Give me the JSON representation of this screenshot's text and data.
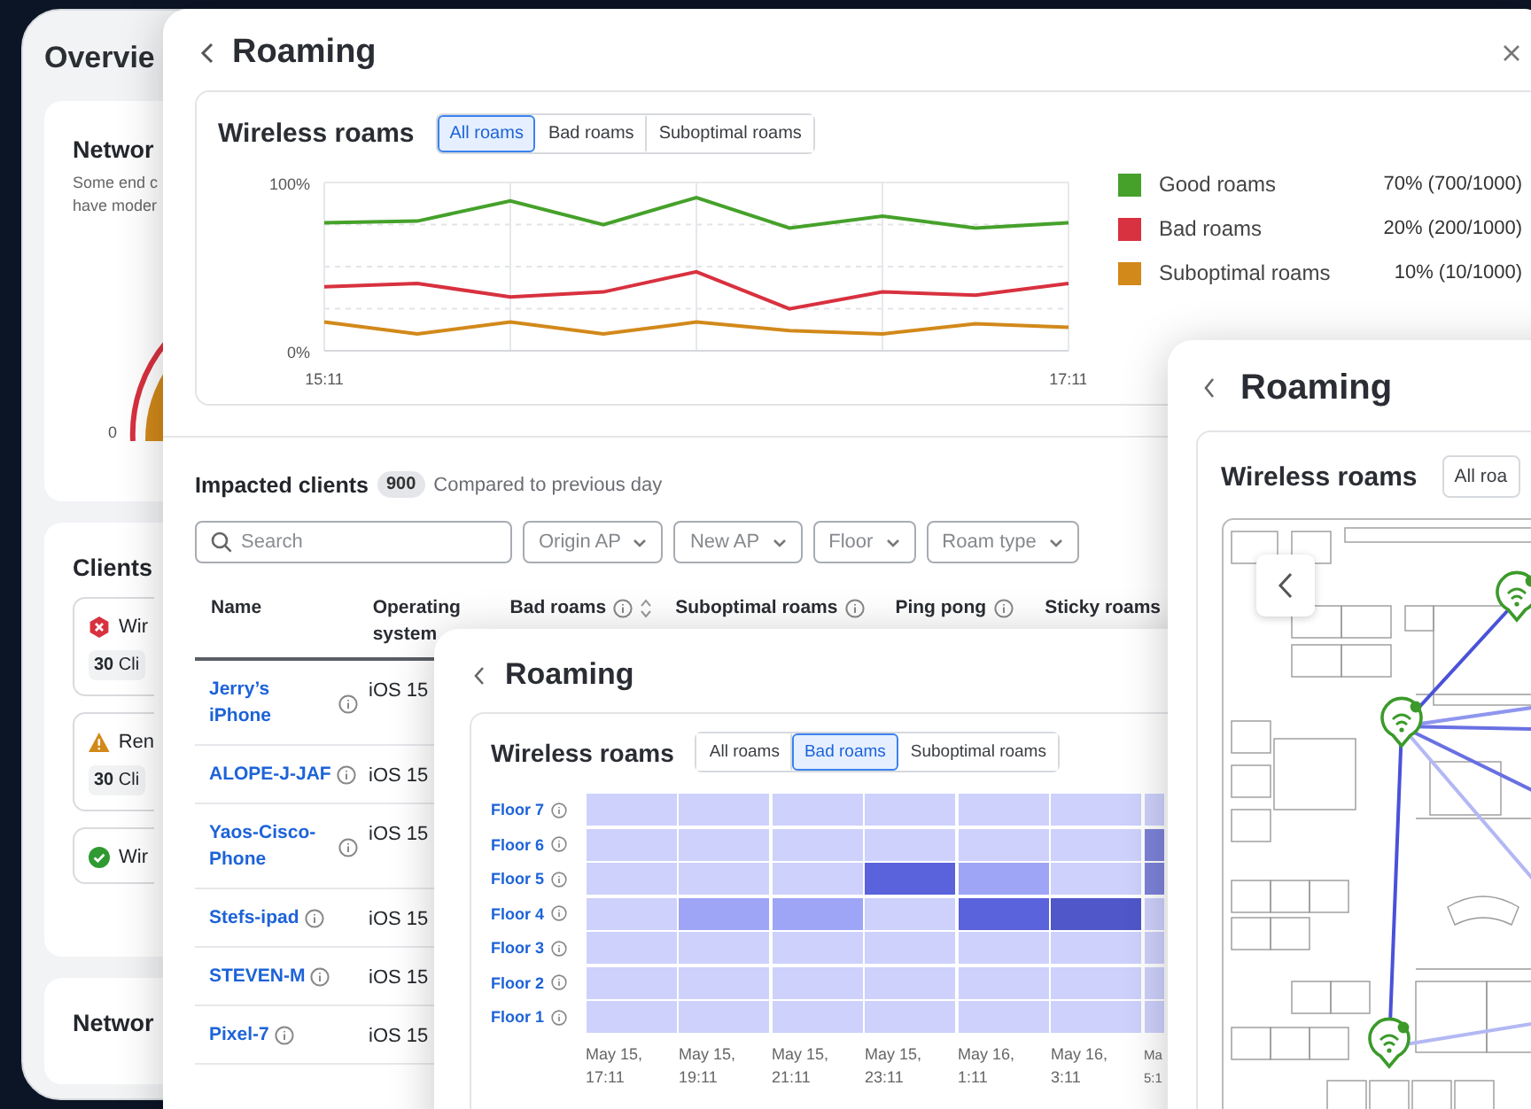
{
  "overview": {
    "title": "Overvie",
    "network_card": {
      "title": "Networ",
      "description_lines": [
        "Some end c",
        "have moder"
      ],
      "gauge_label": "0"
    },
    "clients_card": {
      "title": "Clients",
      "items": [
        {
          "kind": "error",
          "label": "Wir",
          "count": "**30** Cli"
        },
        {
          "kind": "warning",
          "label": "Ren",
          "count": "**30** Cli"
        },
        {
          "kind": "ok",
          "label": "Wir"
        }
      ]
    },
    "network_card_2": {
      "title": "Networ"
    }
  },
  "main_panel": {
    "title": "Roaming",
    "roams_card": {
      "title": "Wireless roams",
      "tabs": [
        {
          "label": "All roams",
          "selected": true
        },
        {
          "label": "Bad roams",
          "selected": false
        },
        {
          "label": "Suboptimal roams",
          "selected": false
        }
      ],
      "chart_data": {
        "type": "line",
        "grid": true,
        "categories": [
          "15:11",
          null,
          null,
          null,
          null,
          null,
          null,
          null,
          "17:11"
        ],
        "ylim": [
          0,
          100
        ],
        "yticks": [
          {
            "value": 0,
            "label": "0%"
          },
          {
            "value": 100,
            "label": "100%"
          }
        ],
        "series": [
          {
            "name": "Good roams",
            "color": "#45a12a",
            "values": [
              76,
              77,
              89,
              75,
              91,
              73,
              80,
              73,
              76
            ]
          },
          {
            "name": "Bad roams",
            "color": "#d8313f",
            "values": [
              38,
              40,
              32,
              35,
              47,
              25,
              35,
              33,
              40
            ]
          },
          {
            "name": "Suboptimal roams",
            "color": "#d2891a",
            "values": [
              17,
              10,
              17,
              10,
              17,
              12,
              10,
              16,
              14
            ]
          }
        ]
      },
      "legend_values": [
        "70% (700/1000)",
        "20% (200/1000)",
        "10% (10/1000)"
      ]
    },
    "clients": {
      "title": "Impacted clients",
      "count": "900",
      "comparison": "Compared to previous day",
      "search": {
        "placeholder": "Search"
      },
      "filters": [
        "Origin AP",
        "New AP",
        "Floor",
        "Roam type"
      ],
      "columns": [
        {
          "label": "Name",
          "info": false,
          "sortable": false
        },
        {
          "label": "Operating system",
          "info": false,
          "sortable": false
        },
        {
          "label": "Bad roams",
          "info": true,
          "sortable": true
        },
        {
          "label": "Suboptimal roams",
          "info": true,
          "sortable": false
        },
        {
          "label": "Ping pong",
          "info": true,
          "sortable": false
        },
        {
          "label": "Sticky roams",
          "info": false,
          "sortable": false
        }
      ],
      "rows": [
        {
          "name": "Jerry’s iPhone",
          "os": "iOS 15"
        },
        {
          "name": "ALOPE-J-JAF",
          "os": "iOS 15"
        },
        {
          "name": "Yaos-Cisco-Phone",
          "os": "iOS 15"
        },
        {
          "name": "Stefs-ipad",
          "os": "iOS 15"
        },
        {
          "name": "STEVEN-M",
          "os": "iOS 15"
        },
        {
          "name": "Pixel-7",
          "os": "iOS 15"
        }
      ]
    }
  },
  "heatmap_panel": {
    "title": "Roaming",
    "card_title": "Wireless roams",
    "tabs": [
      {
        "label": "All roams",
        "selected": false
      },
      {
        "label": "Bad roams",
        "selected": true
      },
      {
        "label": "Suboptimal roams",
        "selected": false
      }
    ],
    "rows": [
      {
        "label": "Floor 7",
        "cells": [
          {
            "color": "#cdd1fb"
          },
          {
            "color": "#cdd1fb"
          },
          {
            "color": "#cdd1fb"
          },
          {
            "color": "#cdd1fb"
          },
          {
            "color": "#cdd1fb"
          },
          {
            "color": "#cdd1fb"
          },
          {
            "color": "#cdd1fb"
          }
        ]
      },
      {
        "label": "Floor 6",
        "cells": [
          {
            "color": "#cdd1fb"
          },
          {
            "color": "#cdd1fb"
          },
          {
            "color": "#cdd1fb"
          },
          {
            "color": "#cdd1fb"
          },
          {
            "color": "#cdd1fb"
          },
          {
            "color": "#cdd1fb"
          },
          {
            "color": "#7d83d9"
          }
        ]
      },
      {
        "label": "Floor 5",
        "cells": [
          {
            "color": "#cdd1fb"
          },
          {
            "color": "#cdd1fb"
          },
          {
            "color": "#cdd1fb"
          },
          {
            "color": "#5a62dc"
          },
          {
            "color": "#9ea5f6"
          },
          {
            "color": "#cdd1fb"
          },
          {
            "color": "#7d83d9"
          }
        ]
      },
      {
        "label": "Floor 4",
        "cells": [
          {
            "color": "#cdd1fb"
          },
          {
            "color": "#9ea5f6"
          },
          {
            "color": "#9ea5f6"
          },
          {
            "color": "#cdd1fb"
          },
          {
            "color": "#5a62dc"
          },
          {
            "color": "#4f57c9"
          },
          {
            "color": "#cdd1fb"
          }
        ]
      },
      {
        "label": "Floor 3",
        "cells": [
          {
            "color": "#cdd1fb"
          },
          {
            "color": "#cdd1fb"
          },
          {
            "color": "#cdd1fb"
          },
          {
            "color": "#cdd1fb"
          },
          {
            "color": "#cdd1fb"
          },
          {
            "color": "#cdd1fb"
          },
          {
            "color": "#cdd1fb"
          }
        ]
      },
      {
        "label": "Floor 2",
        "cells": [
          {
            "color": "#cdd1fb"
          },
          {
            "color": "#cdd1fb"
          },
          {
            "color": "#cdd1fb"
          },
          {
            "color": "#cdd1fb"
          },
          {
            "color": "#cdd1fb"
          },
          {
            "color": "#cdd1fb"
          },
          {
            "color": "#cdd1fb"
          }
        ]
      },
      {
        "label": "Floor 1",
        "cells": [
          {
            "color": "#cdd1fb"
          },
          {
            "color": "#cdd1fb"
          },
          {
            "color": "#cdd1fb"
          },
          {
            "color": "#cdd1fb"
          },
          {
            "color": "#cdd1fb"
          },
          {
            "color": "#cdd1fb"
          },
          {
            "color": "#cdd1fb"
          }
        ]
      }
    ],
    "columns": [
      "May 15, 17:11",
      "May 15, 19:11",
      "May 15, 21:11",
      "May 15, 23:11",
      "May 16, 1:11",
      "May 16, 3:11",
      "Ma 5:1"
    ]
  },
  "map_panel": {
    "title": "Roaming",
    "card_title": "Wireless roams",
    "tabs": [
      {
        "label": "All roa",
        "selected": false
      }
    ]
  }
}
